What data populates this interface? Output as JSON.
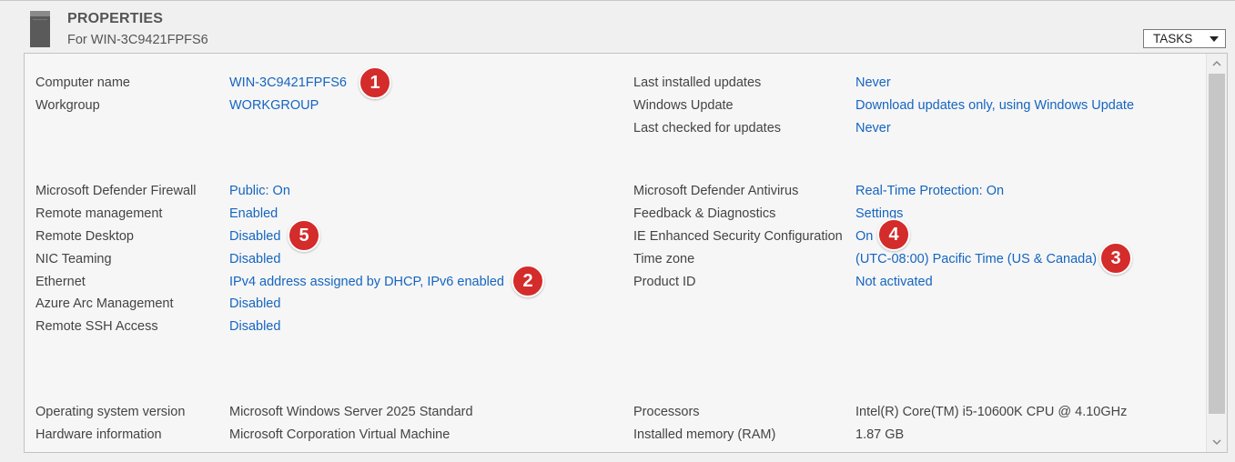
{
  "header": {
    "title": "PROPERTIES",
    "subtitle": "For WIN-3C9421FPFS6",
    "tasks_label": "TASKS",
    "icon": "server-icon"
  },
  "left": {
    "computer_name": {
      "label": "Computer name",
      "value": "WIN-3C9421FPFS6"
    },
    "workgroup": {
      "label": "Workgroup",
      "value": "WORKGROUP"
    },
    "firewall": {
      "label": "Microsoft Defender Firewall",
      "value": "Public: On"
    },
    "remote_management": {
      "label": "Remote management",
      "value": "Enabled"
    },
    "remote_desktop": {
      "label": "Remote Desktop",
      "value": "Disabled"
    },
    "nic_teaming": {
      "label": "NIC Teaming",
      "value": "Disabled"
    },
    "ethernet": {
      "label": "Ethernet",
      "value": "IPv4 address assigned by DHCP, IPv6 enabled"
    },
    "azure_arc": {
      "label": "Azure Arc Management",
      "value": "Disabled"
    },
    "remote_ssh": {
      "label": "Remote SSH Access",
      "value": "Disabled"
    },
    "os_version": {
      "label": "Operating system version",
      "value": "Microsoft Windows Server 2025 Standard"
    },
    "hardware": {
      "label": "Hardware information",
      "value": "Microsoft Corporation Virtual Machine"
    }
  },
  "right": {
    "last_installed": {
      "label": "Last installed updates",
      "value": "Never"
    },
    "windows_update": {
      "label": "Windows Update",
      "value": "Download updates only, using Windows Update"
    },
    "last_checked": {
      "label": "Last checked for updates",
      "value": "Never"
    },
    "antivirus": {
      "label": "Microsoft Defender Antivirus",
      "value": "Real-Time Protection: On"
    },
    "feedback": {
      "label": "Feedback & Diagnostics",
      "value": "Settings"
    },
    "ie_esc": {
      "label": "IE Enhanced Security Configuration",
      "value": "On"
    },
    "time_zone": {
      "label": "Time zone",
      "value": "(UTC-08:00) Pacific Time (US & Canada)"
    },
    "product_id": {
      "label": "Product ID",
      "value": "Not activated"
    },
    "processors": {
      "label": "Processors",
      "value": "Intel(R) Core(TM) i5-10600K CPU @ 4.10GHz"
    },
    "memory": {
      "label": "Installed memory (RAM)",
      "value": "1.87 GB"
    }
  },
  "badges": {
    "b1": "1",
    "b2": "2",
    "b3": "3",
    "b4": "4",
    "b5": "5"
  },
  "colors": {
    "link": "#1565c0",
    "badge": "#d42b2b",
    "text": "#444444"
  }
}
